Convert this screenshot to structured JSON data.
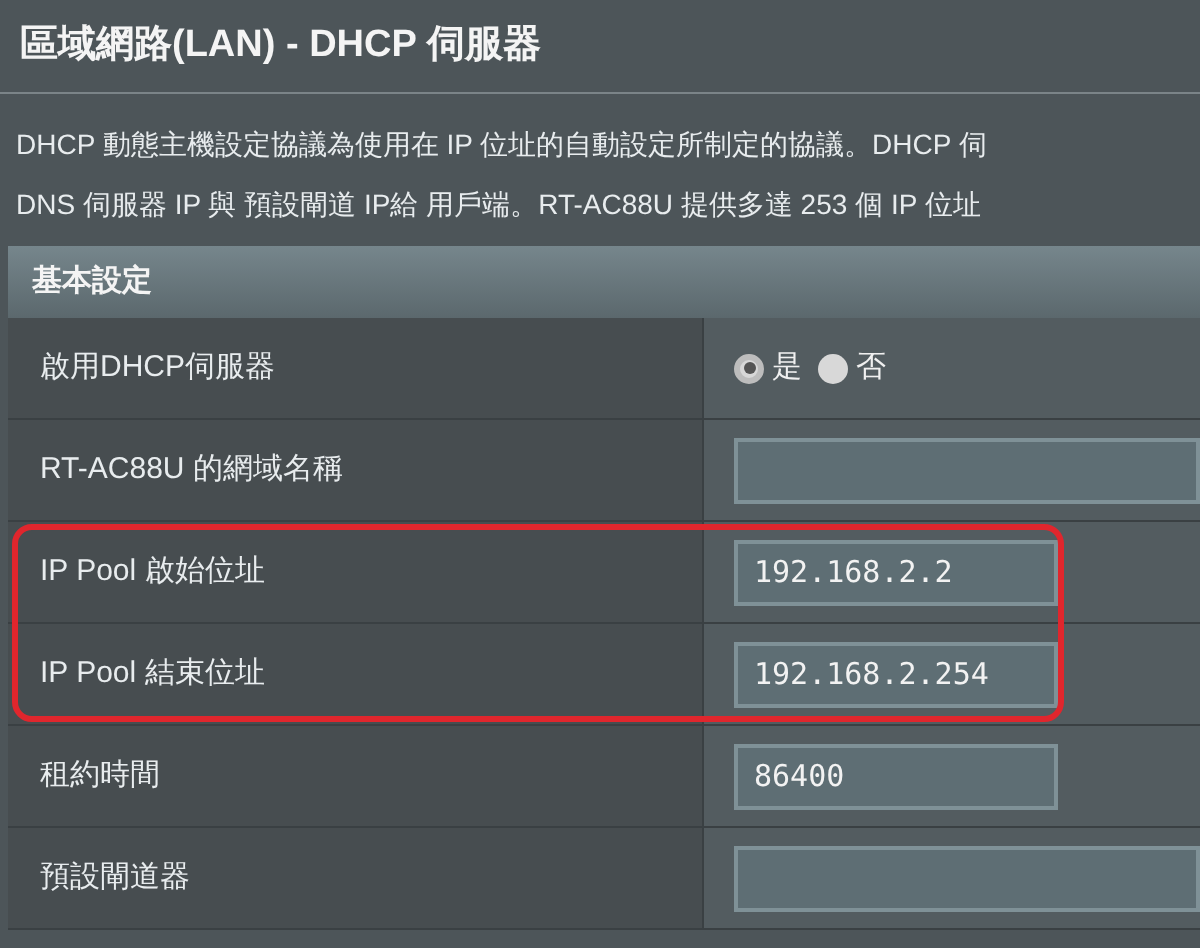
{
  "title": "區域網路(LAN) - DHCP 伺服器",
  "description": [
    "DHCP 動態主機設定協議為使用在 IP 位址的自動設定所制定的協議。DHCP 伺",
    "DNS 伺服器 IP 與 預設閘道 IP給 用戶端。RT-AC88U 提供多達 253 個 IP 位址"
  ],
  "section": "基本設定",
  "rows": [
    {
      "label": "啟用DHCP伺服器",
      "kind": "radio",
      "options": [
        {
          "label": "是",
          "selected": true
        },
        {
          "label": "否",
          "selected": false
        }
      ]
    },
    {
      "label": "RT-AC88U 的網域名稱",
      "kind": "input",
      "wide": true
    },
    {
      "label": "IP Pool 啟始位址",
      "kind": "input",
      "value": "192.168.2.2",
      "highlighted": true
    },
    {
      "label": "IP Pool 結束位址",
      "kind": "input",
      "value": "192.168.2.254",
      "highlighted": true
    },
    {
      "label": "租約時間",
      "kind": "input",
      "value": "86400"
    },
    {
      "label": "預設閘道器",
      "kind": "input",
      "wide": true
    }
  ]
}
